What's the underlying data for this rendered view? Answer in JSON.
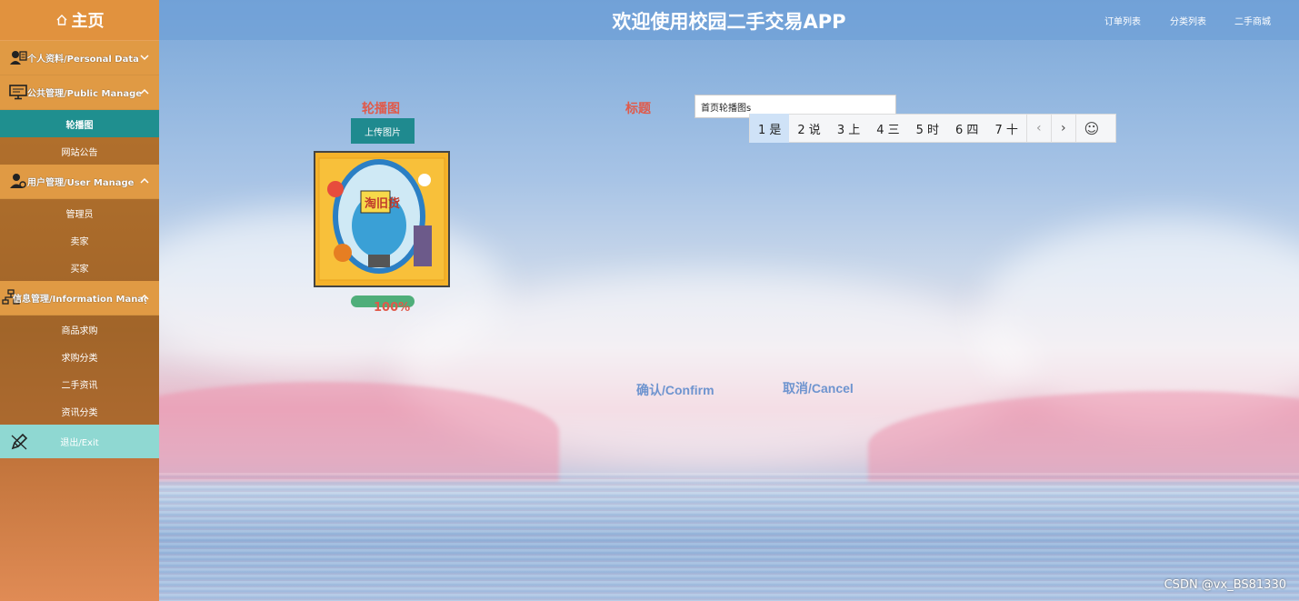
{
  "sidebar": {
    "home_label": "主页",
    "groups": [
      {
        "label": "个人资料/Personal Data",
        "icon": "user-card-icon",
        "expanded": false,
        "items": []
      },
      {
        "label": "公共管理/Public Manage",
        "icon": "monitor-icon",
        "expanded": true,
        "items": [
          "轮播图",
          "网站公告"
        ]
      },
      {
        "label": "用户管理/User Manage",
        "icon": "user-settings-icon",
        "expanded": true,
        "items": [
          "管理员",
          "卖家",
          "买家"
        ]
      },
      {
        "label": "信息管理/Information Manage",
        "icon": "hierarchy-icon",
        "expanded": true,
        "items": [
          "商品求购",
          "求购分类",
          "二手资讯",
          "资讯分类"
        ]
      }
    ],
    "active_item": "轮播图",
    "exit_label": "退出/Exit"
  },
  "header": {
    "title": "欢迎使用校园二手交易APP",
    "nav": [
      "订单列表",
      "分类列表",
      "二手商城"
    ]
  },
  "form": {
    "carousel_label": "轮播图",
    "upload_button": "上传图片",
    "upload_progress_percent": 100,
    "upload_progress_text": "100%",
    "title_label": "标题",
    "title_value": "首页轮播图s",
    "confirm_label": "确认/Confirm",
    "cancel_label": "取消/Cancel"
  },
  "ime": {
    "candidates": [
      "1 是",
      "2 说",
      "3 上",
      "4 三",
      "5 时",
      "6 四",
      "7 十"
    ],
    "selected_index": 0,
    "prev_label": "‹",
    "next_label": "›",
    "emoji_label": "☺"
  },
  "watermark": "CSDN @vx_BS81330",
  "colors": {
    "sidebar_orange": "#e09a44",
    "active_teal": "#1f8f8f",
    "exit_cyan": "#8fd8d2",
    "label_red": "#e05a4a",
    "confirm_blue": "#6e94cf"
  }
}
